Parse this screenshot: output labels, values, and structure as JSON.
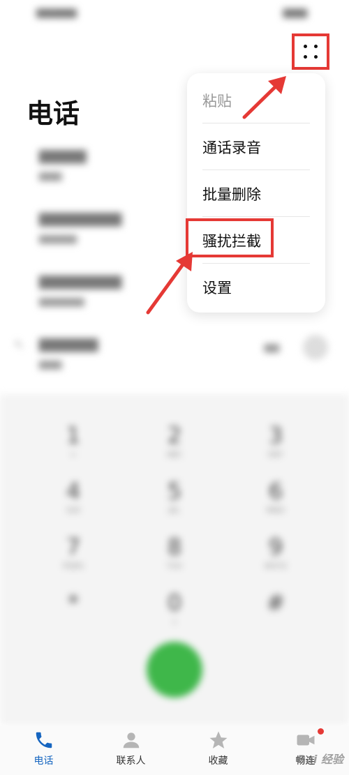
{
  "page_title": "电话",
  "colors": {
    "accent": "#1565c0",
    "call_green": "#3fb74a",
    "annotation_red": "#e53935"
  },
  "more_button": {
    "icon": "four-dots-icon"
  },
  "menu": {
    "items": [
      {
        "label": "粘贴",
        "enabled": false
      },
      {
        "label": "通话录音",
        "enabled": true
      },
      {
        "label": "批量删除",
        "enabled": true
      },
      {
        "label": "骚扰拦截",
        "enabled": true,
        "highlighted": true
      },
      {
        "label": "设置",
        "enabled": true
      }
    ]
  },
  "dialpad": {
    "keys": [
      {
        "digit": "1",
        "letters": "∞"
      },
      {
        "digit": "2",
        "letters": "ABC"
      },
      {
        "digit": "3",
        "letters": "DEF"
      },
      {
        "digit": "4",
        "letters": "GHI"
      },
      {
        "digit": "5",
        "letters": "JKL"
      },
      {
        "digit": "6",
        "letters": "MNO"
      },
      {
        "digit": "7",
        "letters": "PQRS"
      },
      {
        "digit": "8",
        "letters": "TUV"
      },
      {
        "digit": "9",
        "letters": "WXYZ"
      },
      {
        "digit": "*",
        "letters": ""
      },
      {
        "digit": "0",
        "letters": "+"
      },
      {
        "digit": "#",
        "letters": ""
      }
    ]
  },
  "bottom_nav": {
    "items": [
      {
        "label": "电话",
        "icon": "phone-icon",
        "active": true
      },
      {
        "label": "联系人",
        "icon": "person-icon",
        "active": false
      },
      {
        "label": "收藏",
        "icon": "star-icon",
        "active": false
      },
      {
        "label": "畅连",
        "icon": "meetime-icon",
        "active": false,
        "badge": true
      }
    ]
  },
  "watermark": "Bai 经验"
}
